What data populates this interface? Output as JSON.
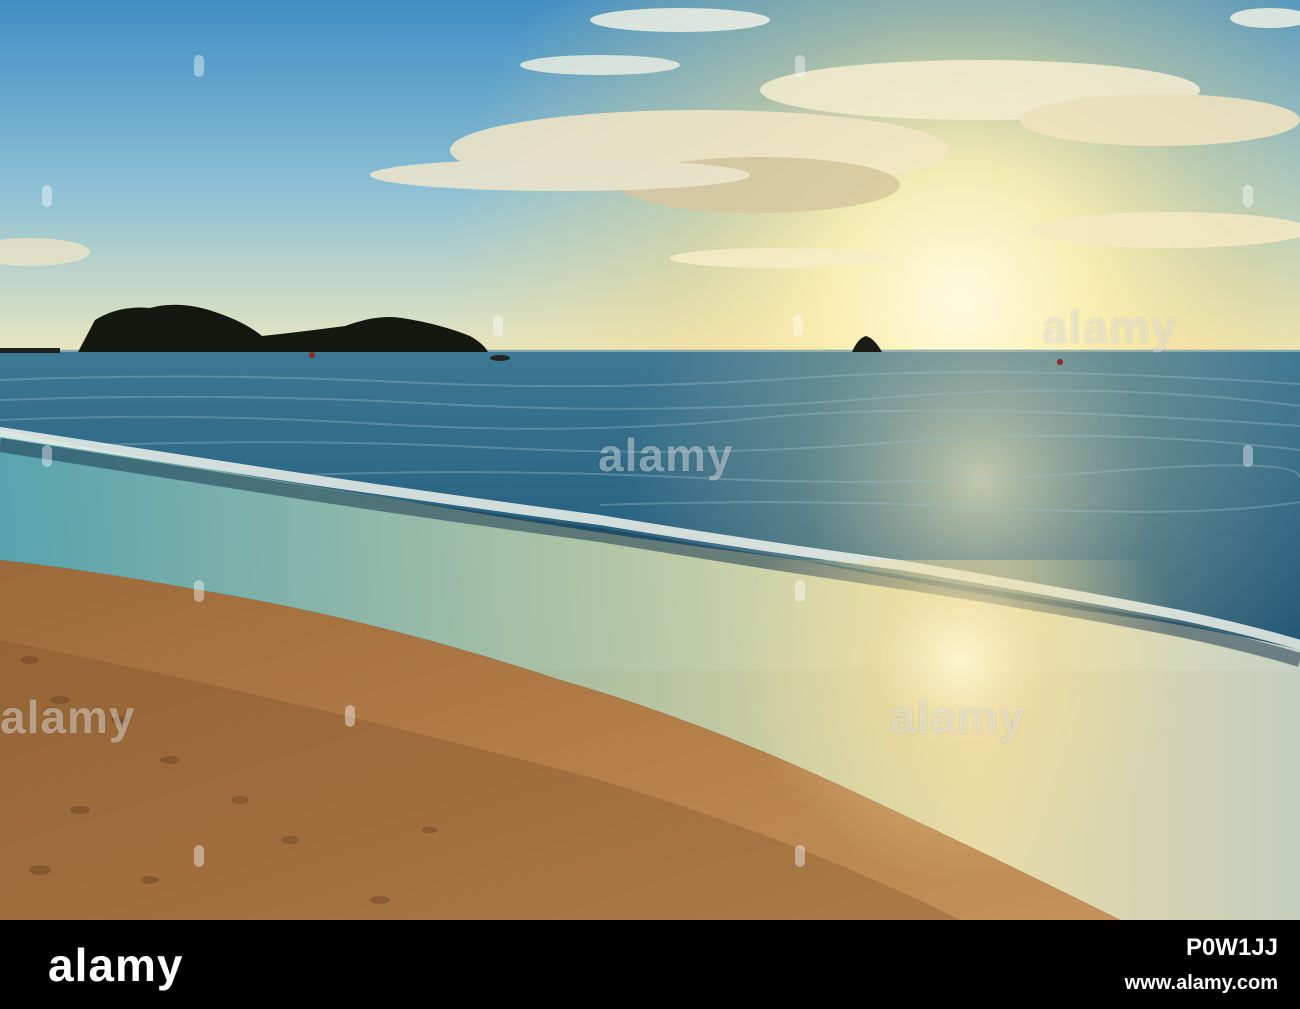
{
  "image": {
    "scene": "sunset-beach",
    "colors": {
      "sky_top": "#4a97c9",
      "sky_mid": "#a8cfd6",
      "sun_glow": "#fff6c8",
      "sea": "#2f6f8e",
      "sea_dark": "#1c4863",
      "sand": "#b57e49",
      "sand_shadow": "#8a5a31",
      "island": "#141a14"
    }
  },
  "watermark": {
    "text": "alamy"
  },
  "footer": {
    "logo": "alamy",
    "image_id": "P0W1JJ",
    "url": "www.alamy.com"
  }
}
